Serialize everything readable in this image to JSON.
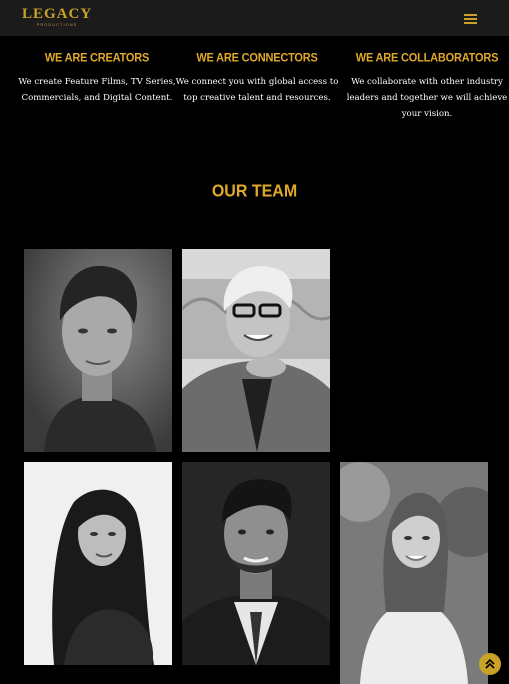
{
  "header": {
    "logo_text": "LEGACY",
    "logo_subtext": "PRODUCTIONS",
    "menu_icon": "hamburger-menu-icon",
    "accent_color": "#c9a227"
  },
  "features": [
    {
      "title": "WE ARE CREATORS",
      "text": "We create Feature Films,  TV Series, Commercials, and Digital Content."
    },
    {
      "title": "WE ARE CONNECTORS",
      "text": "We connect you with global access to top creative talent and resources."
    },
    {
      "title": "WE ARE COLLABORATORS",
      "text": "We collaborate with other industry leaders and together we will achieve your vision."
    }
  ],
  "team": {
    "title": "OUR TEAM"
  },
  "scroll_top_icon": "double-chevron-up-icon"
}
